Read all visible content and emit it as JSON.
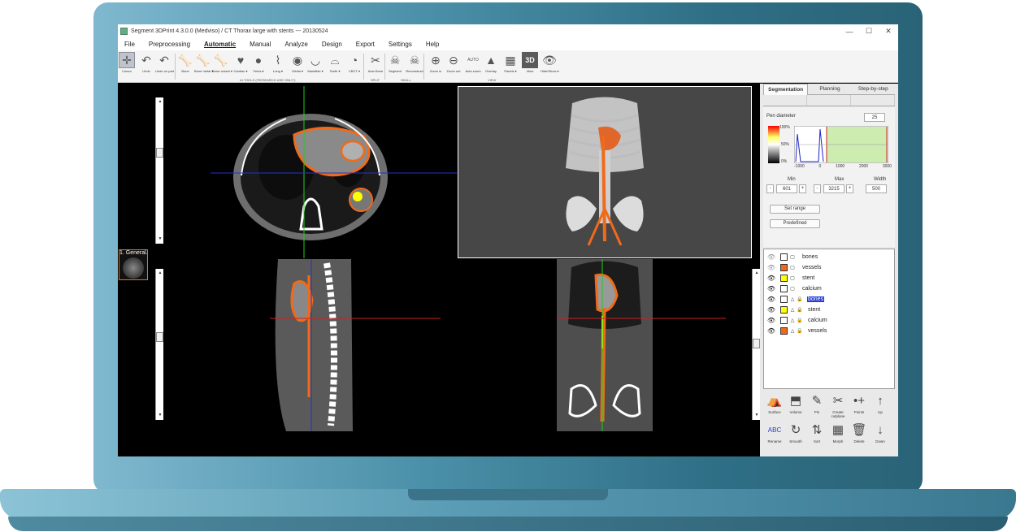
{
  "window": {
    "title": "Segment 3DPrint 4.3.0.0 (Medviso) / CT Thorax large with stents  --- 20130524",
    "controls": [
      "—",
      "☐",
      "✕"
    ]
  },
  "menu": {
    "items": [
      "File",
      "Preprocessing",
      "Automatic",
      "Manual",
      "Analyze",
      "Design",
      "Export",
      "Settings",
      "Help"
    ],
    "active": "Automatic"
  },
  "toolbar": {
    "tools": [
      {
        "id": "cursor",
        "label": "Cursor",
        "icon": "cursor-icon",
        "glyph": "✛"
      },
      {
        "id": "undo",
        "label": "Undo",
        "icon": "undo-icon",
        "glyph": "↶"
      },
      {
        "id": "undo-on-part",
        "label": "Undo on part",
        "icon": "undo-on-part-icon",
        "glyph": "↶"
      },
      {
        "id": "bone",
        "label": "Bone",
        "icon": "bone-icon",
        "glyph": "🦴"
      },
      {
        "id": "bone-metal",
        "label": "Bone metal ▾",
        "icon": "bone-metal-icon",
        "glyph": "🦴"
      },
      {
        "id": "bone-vessel",
        "label": "Bone vessel ▾",
        "icon": "bone-vessel-icon",
        "glyph": "🦴"
      },
      {
        "id": "cardiac",
        "label": "Cardiac ▾",
        "icon": "heart-icon",
        "glyph": "♥"
      },
      {
        "id": "fetus",
        "label": "Fetus ▾",
        "icon": "fetus-icon",
        "glyph": "●"
      },
      {
        "id": "lung",
        "label": "Lung ▾",
        "icon": "lung-icon",
        "glyph": "⌇"
      },
      {
        "id": "orbita",
        "label": "Orbita ▾",
        "icon": "orbita-icon",
        "glyph": "◉"
      },
      {
        "id": "mandible",
        "label": "Mandible ▾",
        "icon": "mandible-icon",
        "glyph": "◡"
      },
      {
        "id": "teeth",
        "label": "Teeth ▾",
        "icon": "tooth-icon",
        "glyph": "⌓"
      },
      {
        "id": "cbct",
        "label": "CBCT ▾",
        "icon": "cbct-icon",
        "glyph": "◔"
      },
      {
        "id": "auto-bone-split",
        "label": "Auto Bone",
        "icon": "auto-bone-split-icon",
        "glyph": "✂"
      },
      {
        "id": "segment",
        "label": "Segment",
        "icon": "skull-icon",
        "glyph": "☠"
      },
      {
        "id": "reconstruct",
        "label": "Reconstruct",
        "icon": "skull-reconstruct-icon",
        "glyph": "☠"
      },
      {
        "id": "zoom-in",
        "label": "Zoom in",
        "icon": "zoom-in-icon",
        "glyph": "⊕"
      },
      {
        "id": "zoom-out",
        "label": "Zoom out",
        "icon": "zoom-out-icon",
        "glyph": "⊖"
      },
      {
        "id": "auto-zoom",
        "label": "Auto zoom",
        "icon": "auto-zoom-icon",
        "glyph": "AUTO"
      },
      {
        "id": "overlay",
        "label": "Overlay",
        "icon": "overlay-icon",
        "glyph": "▲"
      },
      {
        "id": "panels",
        "label": "Panels ▾",
        "icon": "panels-icon",
        "glyph": "▦"
      },
      {
        "id": "view",
        "label": "View",
        "icon": "view-3d-icon",
        "glyph": "3D"
      },
      {
        "id": "hide-show",
        "label": "Hide/Show ▾",
        "icon": "eye-icon",
        "glyph": "👁"
      }
    ],
    "groups": {
      "ai_tools": "AI TOOLS (*RESEARCH USE ONLY*)",
      "split": "SPLIT",
      "skull": "SKULL",
      "view": "VIEW"
    }
  },
  "thumbnail": {
    "label": "1. General."
  },
  "panel": {
    "tabs": [
      "Segmentation",
      "Planning",
      "Step-by-step"
    ],
    "active_tab": "Segmentation",
    "pen_diameter_label": "Pen diameter",
    "pen_diameter_value": "25",
    "colorbar_labels": [
      "100%",
      "50%",
      "0%"
    ],
    "histogram_axis": [
      "-1000",
      "0",
      "1000",
      "2000",
      "3000"
    ],
    "min_label": "Min",
    "max_label": "Max",
    "width_label": "Width",
    "min_value": "601",
    "max_value": "3215",
    "width_value": "500",
    "minus": "-",
    "plus": "+",
    "set_range": "Set range",
    "predefined": "Predefined"
  },
  "objects": [
    {
      "name": "bones",
      "color": "#ffffff",
      "kind": "surface",
      "visible": false,
      "selected": false
    },
    {
      "name": "vessels",
      "color": "#f06a1a",
      "kind": "surface",
      "visible": false,
      "selected": false
    },
    {
      "name": "stent",
      "color": "#ffff00",
      "kind": "surface",
      "visible": true,
      "selected": false
    },
    {
      "name": "calcium",
      "color": "#ffffff",
      "kind": "surface",
      "visible": true,
      "selected": false
    },
    {
      "name": "bones",
      "color": "#ffffff",
      "kind": "mask",
      "visible": true,
      "selected": true
    },
    {
      "name": "stent",
      "color": "#ffff00",
      "kind": "mask",
      "visible": true,
      "selected": false
    },
    {
      "name": "calcium",
      "color": "#ffffff",
      "kind": "mask",
      "visible": true,
      "selected": false
    },
    {
      "name": "vessels",
      "color": "#f06a1a",
      "kind": "mask",
      "visible": true,
      "selected": false
    }
  ],
  "actions": [
    {
      "label": "Surface",
      "icon": "surface-icon",
      "glyph": "⛺"
    },
    {
      "label": "Volume",
      "icon": "volume-icon",
      "glyph": "⬒"
    },
    {
      "label": "Pin",
      "icon": "pin-icon",
      "glyph": "✎"
    },
    {
      "label": "Create cutplane",
      "icon": "cutplane-icon",
      "glyph": "✂"
    },
    {
      "label": "Points",
      "icon": "points-icon",
      "glyph": "•+"
    },
    {
      "label": "Up",
      "icon": "arrow-up-icon",
      "glyph": "↑"
    },
    {
      "label": "Rename",
      "icon": "rename-icon",
      "glyph": "ABC"
    },
    {
      "label": "Smooth",
      "icon": "smooth-icon",
      "glyph": "↻"
    },
    {
      "label": "Sort",
      "icon": "sort-icon",
      "glyph": "⇅"
    },
    {
      "label": "Morph",
      "icon": "morph-icon",
      "glyph": "▦"
    },
    {
      "label": "Delete",
      "icon": "trash-icon",
      "glyph": "🗑"
    },
    {
      "label": "Down",
      "icon": "arrow-down-icon",
      "glyph": "↓"
    }
  ],
  "colors": {
    "laptop_frame": "#3f8197",
    "segmentation_orange": "#f06a1a",
    "stent_yellow": "#ffff00",
    "crosshair_green": "#22cc22",
    "crosshair_blue": "#2233cc",
    "crosshair_red": "#cc2222",
    "selection_blue": "#2a3bd0"
  }
}
